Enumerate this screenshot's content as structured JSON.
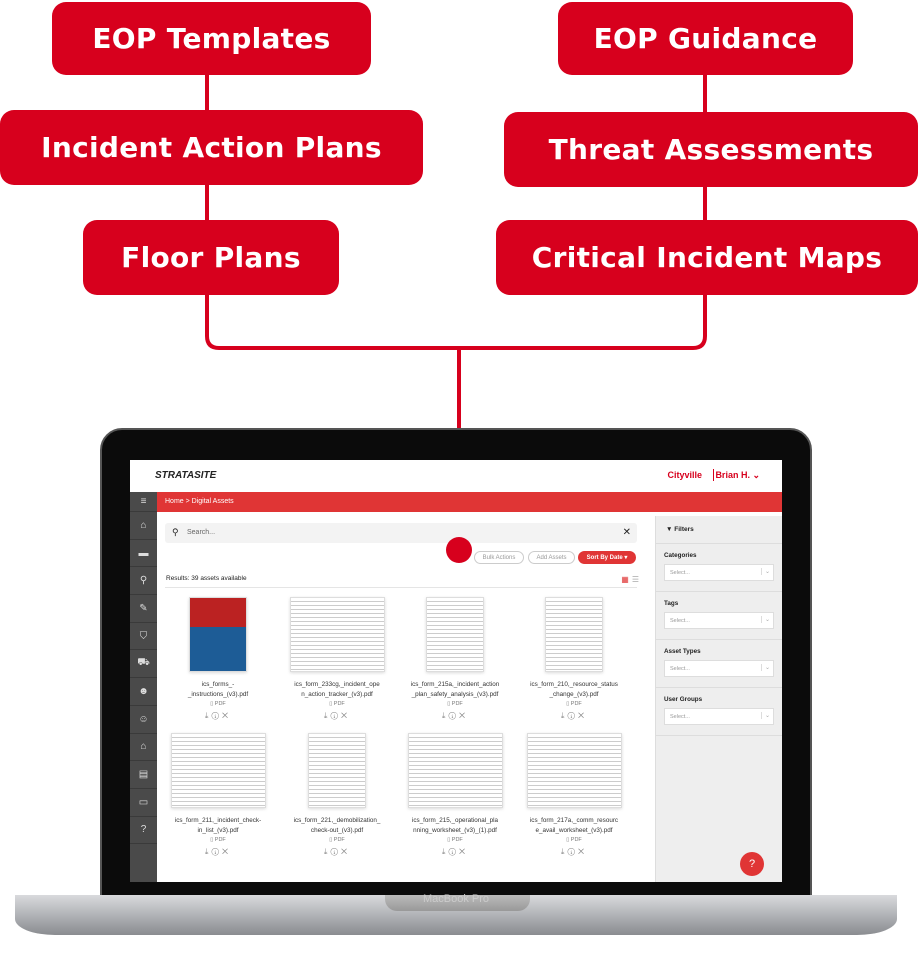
{
  "labels": {
    "eop_templates": "EOP Templates",
    "incident_action_plans": "Incident Action Plans",
    "floor_plans": "Floor Plans",
    "eop_guidance": "EOP Guidance",
    "threat_assessments": "Threat Assessments",
    "critical_incident_maps": "Critical Incident Maps"
  },
  "colors": {
    "brand_red": "#d7001d",
    "app_red": "#e03535",
    "sidebar": "#4a4a4a"
  },
  "device": {
    "name": "MacBook Pro"
  },
  "app": {
    "logo": "STRATASITE",
    "header": {
      "org": "Cityville",
      "user": "Brian H. ⌄"
    },
    "breadcrumb": "Home  >  Digital Assets",
    "sidebar_icons": [
      "menu-icon",
      "home-icon",
      "folder-icon",
      "map-icon",
      "pin-icon",
      "shield-icon",
      "ambulance-icon",
      "group-icon",
      "users-icon",
      "graduation-cap-icon",
      "clapperboard-icon",
      "window-icon",
      "help-circle-icon"
    ],
    "search": {
      "placeholder": "Search..."
    },
    "buttons": {
      "bulk": "Bulk Actions",
      "add": "Add Assets",
      "sort": "Sort By Date ▾"
    },
    "results": "Results: 39 assets available",
    "assets": [
      {
        "name": "ics_forms_-\n_instructions_(v3).pdf",
        "type": "PDF"
      },
      {
        "name": "ics_form_233cg,_incident_ope\nn_action_tracker_(v3).pdf",
        "type": "PDF"
      },
      {
        "name": "ics_form_215a,_incident_action\n_plan_safety_analysis_(v3).pdf",
        "type": "PDF"
      },
      {
        "name": "ics_form_210,_resource_status\n_change_(v3).pdf",
        "type": "PDF"
      },
      {
        "name": "ics_form_211,_incident_check-\nin_list_(v3).pdf",
        "type": "PDF"
      },
      {
        "name": "ics_form_221,_demobilization_\ncheck-out_(v3).pdf",
        "type": "PDF"
      },
      {
        "name": "ics_form_215,_operational_pla\nnning_worksheet_(v3)_(1).pdf",
        "type": "PDF"
      },
      {
        "name": "ics_form_217a,_comm_resourc\ne_avail_worksheet_(v3).pdf",
        "type": "PDF"
      }
    ],
    "filters": {
      "title": "Filters",
      "groups": [
        {
          "label": "Categories",
          "placeholder": "Select..."
        },
        {
          "label": "Tags",
          "placeholder": "Select..."
        },
        {
          "label": "Asset Types",
          "placeholder": "Select..."
        },
        {
          "label": "User Groups",
          "placeholder": "Select..."
        }
      ]
    },
    "help": "?"
  }
}
